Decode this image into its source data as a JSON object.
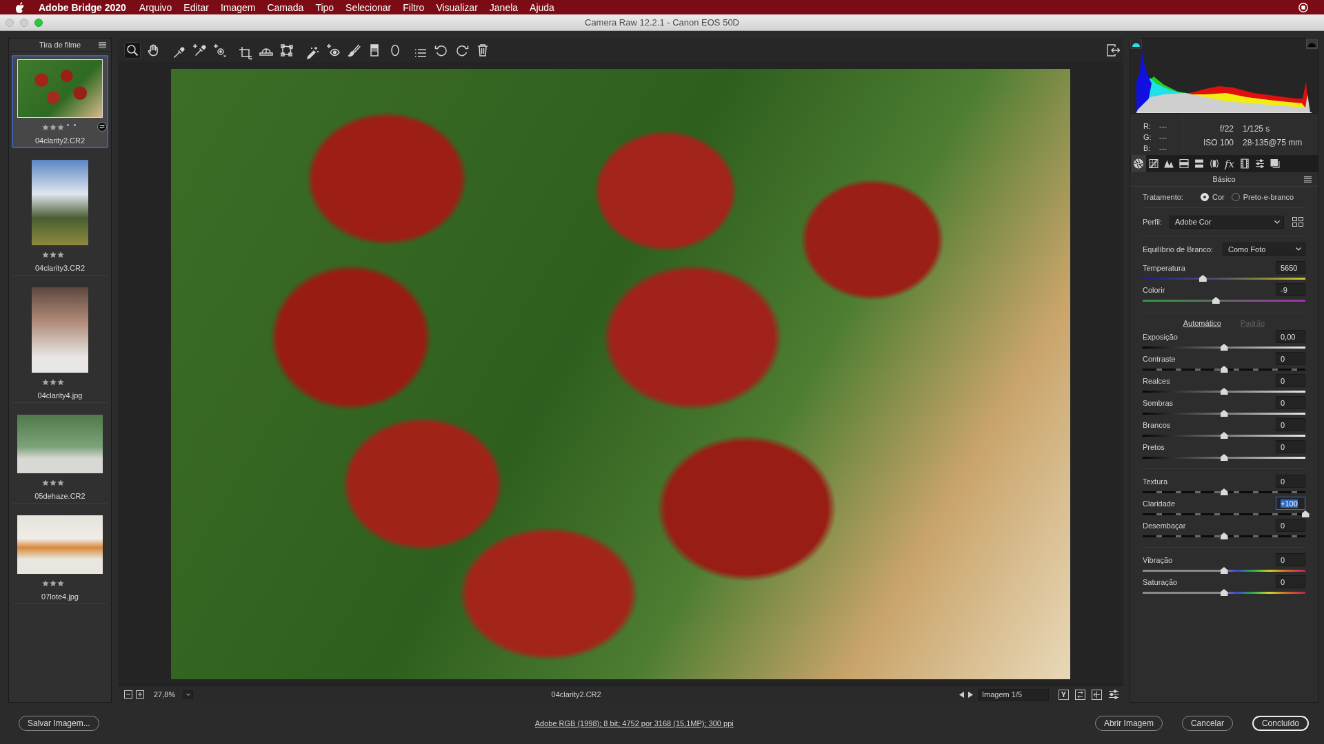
{
  "menubar": {
    "app": "Adobe Bridge 2020",
    "menus": [
      "Arquivo",
      "Editar",
      "Imagem",
      "Camada",
      "Tipo",
      "Selecionar",
      "Filtro",
      "Visualizar",
      "Janela",
      "Ajuda"
    ]
  },
  "window": {
    "title": "Camera Raw 12.2.1 - Canon EOS 50D"
  },
  "filmstrip": {
    "title": "Tira de filme",
    "items": [
      {
        "filename": "04clarity2.CR2",
        "kind": "landscape",
        "stars": 3,
        "selected": true,
        "edited": true
      },
      {
        "filename": "04clarity3.CR2",
        "kind": "portrait",
        "stars": 3,
        "selected": false,
        "edited": false
      },
      {
        "filename": "04clarity4.jpg",
        "kind": "portrait",
        "stars": 3,
        "selected": false,
        "edited": false
      },
      {
        "filename": "05dehaze.CR2",
        "kind": "landscape",
        "stars": 3,
        "selected": false,
        "edited": false
      },
      {
        "filename": "07lote4.jpg",
        "kind": "landscape",
        "stars": 3,
        "selected": false,
        "edited": false
      }
    ]
  },
  "toolbar": {
    "tools": [
      {
        "selected": true
      },
      {
        "selected": false
      },
      {
        "selected": false
      },
      {
        "selected": false
      },
      {
        "selected": false
      },
      {
        "selected": false
      },
      {
        "selected": false
      },
      {
        "selected": false
      },
      {
        "selected": false
      },
      {
        "selected": false
      },
      {
        "selected": false
      },
      {
        "selected": false
      },
      {
        "selected": false
      },
      {
        "selected": false
      },
      {
        "selected": false
      },
      {
        "selected": false
      },
      {
        "selected": false
      }
    ]
  },
  "preview": {
    "zoom": "27,8%",
    "filename": "04clarity2.CR2",
    "counter": "Imagem 1/5",
    "before_after": "Y"
  },
  "panel": {
    "readout": {
      "rgb": [
        {
          "label": "R:",
          "value": "---"
        },
        {
          "label": "G:",
          "value": "---"
        },
        {
          "label": "B:",
          "value": "---"
        }
      ],
      "exif": [
        "f/22",
        "1/125 s",
        "ISO 100",
        "28-135@75 mm"
      ]
    },
    "tabs": [
      {
        "selected": true
      },
      {
        "selected": false
      },
      {
        "selected": false
      },
      {
        "selected": false
      },
      {
        "selected": false
      },
      {
        "selected": false
      },
      {
        "selected": false,
        "glyph": "fx"
      },
      {
        "selected": false
      },
      {
        "selected": false
      },
      {
        "selected": false
      }
    ],
    "title": "Básico",
    "treatment": {
      "label": "Tratamento:",
      "options": [
        {
          "label": "Cor",
          "selected": true
        },
        {
          "label": "Preto-e-branco",
          "selected": false
        }
      ]
    },
    "profile": {
      "label": "Perfil:",
      "value": "Adobe Cor"
    },
    "white_balance": {
      "label": "Equilíbrio de Branco:",
      "value": "Como Foto",
      "sliders": [
        {
          "label": "Temperatura",
          "value": "5650",
          "level": 0.37,
          "kind": "temperature",
          "focused": false
        },
        {
          "label": "Colorir",
          "value": "-9",
          "level": 0.45,
          "kind": "tint",
          "focused": false
        }
      ]
    },
    "auto_links": [
      {
        "label": "Automático",
        "disabled": false
      },
      {
        "label": "Padrão",
        "disabled": true
      }
    ],
    "slider_groups": [
      [
        {
          "label": "Exposição",
          "value": "0,00",
          "level": 0.5,
          "kind": "tone",
          "focused": false
        },
        {
          "label": "Contraste",
          "value": "0",
          "level": 0.5,
          "kind": "dashed",
          "focused": false
        },
        {
          "label": "Realces",
          "value": "0",
          "level": 0.5,
          "kind": "tone",
          "focused": false
        },
        {
          "label": "Sombras",
          "value": "0",
          "level": 0.5,
          "kind": "tone",
          "focused": false
        },
        {
          "label": "Brancos",
          "value": "0",
          "level": 0.5,
          "kind": "tone",
          "focused": false
        },
        {
          "label": "Pretos",
          "value": "0",
          "level": 0.5,
          "kind": "tone",
          "focused": false
        }
      ],
      [
        {
          "label": "Textura",
          "value": "0",
          "level": 0.5,
          "kind": "dashed",
          "focused": false
        },
        {
          "label": "Claridade",
          "value": "+100",
          "level": 1,
          "kind": "dashed",
          "focused": true
        },
        {
          "label": "Desembaçar",
          "value": "0",
          "level": 0.5,
          "kind": "dashed",
          "focused": false
        }
      ],
      [
        {
          "label": "Vibração",
          "value": "0",
          "level": 0.5,
          "kind": "spectrum",
          "focused": false
        },
        {
          "label": "Saturação",
          "value": "0",
          "level": 0.5,
          "kind": "spectrum",
          "focused": false
        }
      ]
    ]
  },
  "footer": {
    "save": "Salvar Imagem...",
    "workflow": "Adobe RGB (1998); 8 bit; 4752 por 3168 (15,1MP); 300 ppi",
    "buttons": [
      {
        "label": "Abrir Imagem",
        "default": false
      },
      {
        "label": "Cancelar",
        "default": false
      },
      {
        "label": "Concluído",
        "default": true
      }
    ]
  }
}
